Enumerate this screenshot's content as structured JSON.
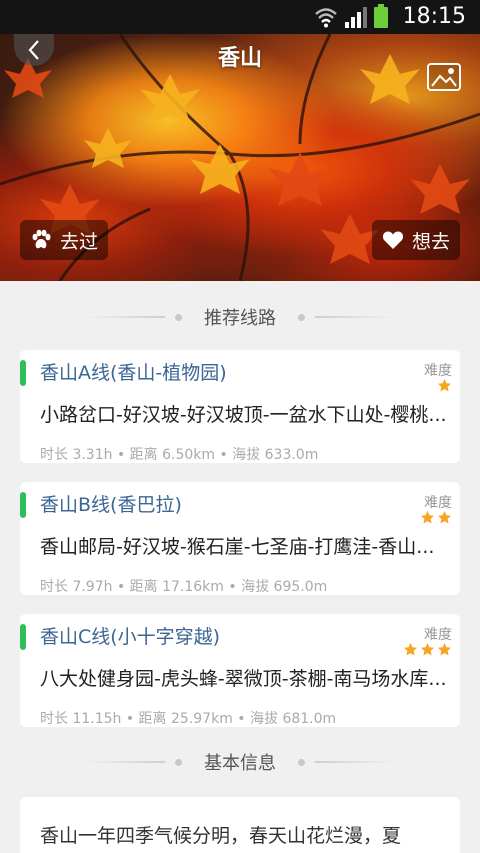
{
  "status": {
    "time": "18:15"
  },
  "header": {
    "title": "香山"
  },
  "actions": {
    "been": "去过",
    "want": "想去"
  },
  "sections": {
    "routes": "推荐线路",
    "basic_info": "基本信息"
  },
  "routes": [
    {
      "name": "香山A线(香山-植物园)",
      "difficulty_label": "难度",
      "stars": 1,
      "path": "小路岔口-好汉坡-好汉坡顶-一盆水下山处-樱桃...",
      "meta": "时长 3.31h • 距离 6.50km • 海拔 633.0m"
    },
    {
      "name": "香山B线(香巴拉)",
      "difficulty_label": "难度",
      "stars": 2,
      "path": "香山邮局-好汉坡-猴石崖-七圣庙-打鹰洼-香山...",
      "meta": "时长 7.97h • 距离 17.16km • 海拔 695.0m"
    },
    {
      "name": "香山C线(小十字穿越)",
      "difficulty_label": "难度",
      "stars": 3,
      "path": "八大处健身园-虎头蜂-翠微顶-茶棚-南马场水库...",
      "meta": "时长 11.15h • 距离 25.97km • 海拔 681.0m"
    }
  ],
  "info": {
    "text": "香山一年四季气候分明，春天山花烂漫，夏"
  },
  "colors": {
    "route_bar": "#2ebf5a",
    "route_name": "#3c6694",
    "star": "#f5a623"
  }
}
